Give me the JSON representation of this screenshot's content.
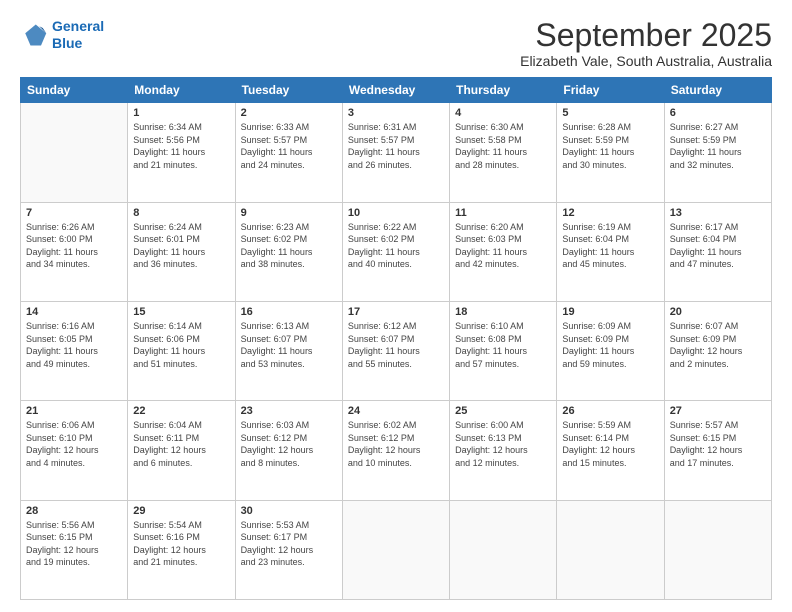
{
  "logo": {
    "line1": "General",
    "line2": "Blue"
  },
  "title": "September 2025",
  "location": "Elizabeth Vale, South Australia, Australia",
  "days_header": [
    "Sunday",
    "Monday",
    "Tuesday",
    "Wednesday",
    "Thursday",
    "Friday",
    "Saturday"
  ],
  "weeks": [
    [
      {
        "day": "",
        "info": ""
      },
      {
        "day": "1",
        "info": "Sunrise: 6:34 AM\nSunset: 5:56 PM\nDaylight: 11 hours\nand 21 minutes."
      },
      {
        "day": "2",
        "info": "Sunrise: 6:33 AM\nSunset: 5:57 PM\nDaylight: 11 hours\nand 24 minutes."
      },
      {
        "day": "3",
        "info": "Sunrise: 6:31 AM\nSunset: 5:57 PM\nDaylight: 11 hours\nand 26 minutes."
      },
      {
        "day": "4",
        "info": "Sunrise: 6:30 AM\nSunset: 5:58 PM\nDaylight: 11 hours\nand 28 minutes."
      },
      {
        "day": "5",
        "info": "Sunrise: 6:28 AM\nSunset: 5:59 PM\nDaylight: 11 hours\nand 30 minutes."
      },
      {
        "day": "6",
        "info": "Sunrise: 6:27 AM\nSunset: 5:59 PM\nDaylight: 11 hours\nand 32 minutes."
      }
    ],
    [
      {
        "day": "7",
        "info": "Sunrise: 6:26 AM\nSunset: 6:00 PM\nDaylight: 11 hours\nand 34 minutes."
      },
      {
        "day": "8",
        "info": "Sunrise: 6:24 AM\nSunset: 6:01 PM\nDaylight: 11 hours\nand 36 minutes."
      },
      {
        "day": "9",
        "info": "Sunrise: 6:23 AM\nSunset: 6:02 PM\nDaylight: 11 hours\nand 38 minutes."
      },
      {
        "day": "10",
        "info": "Sunrise: 6:22 AM\nSunset: 6:02 PM\nDaylight: 11 hours\nand 40 minutes."
      },
      {
        "day": "11",
        "info": "Sunrise: 6:20 AM\nSunset: 6:03 PM\nDaylight: 11 hours\nand 42 minutes."
      },
      {
        "day": "12",
        "info": "Sunrise: 6:19 AM\nSunset: 6:04 PM\nDaylight: 11 hours\nand 45 minutes."
      },
      {
        "day": "13",
        "info": "Sunrise: 6:17 AM\nSunset: 6:04 PM\nDaylight: 11 hours\nand 47 minutes."
      }
    ],
    [
      {
        "day": "14",
        "info": "Sunrise: 6:16 AM\nSunset: 6:05 PM\nDaylight: 11 hours\nand 49 minutes."
      },
      {
        "day": "15",
        "info": "Sunrise: 6:14 AM\nSunset: 6:06 PM\nDaylight: 11 hours\nand 51 minutes."
      },
      {
        "day": "16",
        "info": "Sunrise: 6:13 AM\nSunset: 6:07 PM\nDaylight: 11 hours\nand 53 minutes."
      },
      {
        "day": "17",
        "info": "Sunrise: 6:12 AM\nSunset: 6:07 PM\nDaylight: 11 hours\nand 55 minutes."
      },
      {
        "day": "18",
        "info": "Sunrise: 6:10 AM\nSunset: 6:08 PM\nDaylight: 11 hours\nand 57 minutes."
      },
      {
        "day": "19",
        "info": "Sunrise: 6:09 AM\nSunset: 6:09 PM\nDaylight: 11 hours\nand 59 minutes."
      },
      {
        "day": "20",
        "info": "Sunrise: 6:07 AM\nSunset: 6:09 PM\nDaylight: 12 hours\nand 2 minutes."
      }
    ],
    [
      {
        "day": "21",
        "info": "Sunrise: 6:06 AM\nSunset: 6:10 PM\nDaylight: 12 hours\nand 4 minutes."
      },
      {
        "day": "22",
        "info": "Sunrise: 6:04 AM\nSunset: 6:11 PM\nDaylight: 12 hours\nand 6 minutes."
      },
      {
        "day": "23",
        "info": "Sunrise: 6:03 AM\nSunset: 6:12 PM\nDaylight: 12 hours\nand 8 minutes."
      },
      {
        "day": "24",
        "info": "Sunrise: 6:02 AM\nSunset: 6:12 PM\nDaylight: 12 hours\nand 10 minutes."
      },
      {
        "day": "25",
        "info": "Sunrise: 6:00 AM\nSunset: 6:13 PM\nDaylight: 12 hours\nand 12 minutes."
      },
      {
        "day": "26",
        "info": "Sunrise: 5:59 AM\nSunset: 6:14 PM\nDaylight: 12 hours\nand 15 minutes."
      },
      {
        "day": "27",
        "info": "Sunrise: 5:57 AM\nSunset: 6:15 PM\nDaylight: 12 hours\nand 17 minutes."
      }
    ],
    [
      {
        "day": "28",
        "info": "Sunrise: 5:56 AM\nSunset: 6:15 PM\nDaylight: 12 hours\nand 19 minutes."
      },
      {
        "day": "29",
        "info": "Sunrise: 5:54 AM\nSunset: 6:16 PM\nDaylight: 12 hours\nand 21 minutes."
      },
      {
        "day": "30",
        "info": "Sunrise: 5:53 AM\nSunset: 6:17 PM\nDaylight: 12 hours\nand 23 minutes."
      },
      {
        "day": "",
        "info": ""
      },
      {
        "day": "",
        "info": ""
      },
      {
        "day": "",
        "info": ""
      },
      {
        "day": "",
        "info": ""
      }
    ]
  ]
}
